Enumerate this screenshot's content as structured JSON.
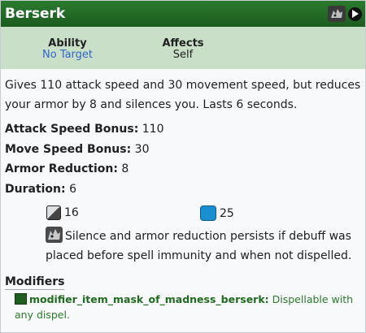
{
  "ability": {
    "title": "Berserk",
    "header_icons": [
      "berserk-ability-icon",
      "play-icon"
    ]
  },
  "info": {
    "ability_label": "Ability",
    "ability_value": "No Target",
    "affects_label": "Affects",
    "affects_value": "Self"
  },
  "description": "Gives 110 attack speed and 30 movement speed, but reduces your armor by 8 and silences you. Lasts 6 seconds.",
  "stats": [
    {
      "label": "Attack Speed Bonus:",
      "value": "110"
    },
    {
      "label": "Move Speed Bonus:",
      "value": "30"
    },
    {
      "label": "Armor Reduction:",
      "value": "8"
    },
    {
      "label": "Duration:",
      "value": "6"
    }
  ],
  "costs": {
    "cooldown": "16",
    "mana": "25"
  },
  "note": "Silence and armor reduction persists if debuff was placed before spell immunity and when not dispelled.",
  "modifiers": {
    "heading": "Modifiers",
    "items": [
      {
        "name": "modifier_item_mask_of_madness_berserk:",
        "desc": "Dispellable with any dispel."
      }
    ]
  },
  "colors": {
    "header": "#2b7a2e",
    "info_band": "#c9dfc7",
    "link": "#3366cc",
    "mana": "#1a8ed1",
    "modifier_text": "#2a7a2a"
  }
}
